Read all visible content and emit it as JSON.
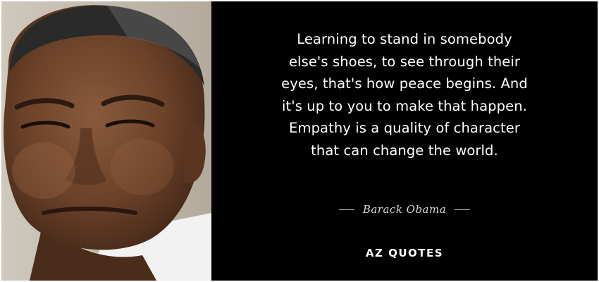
{
  "quote": {
    "lines": [
      "Learning to stand in somebody",
      "else's shoes, to see through their",
      "eyes, that's how peace begins. And",
      "it's up to you to make that happen.",
      "Empathy is a quality of character",
      "that can change the world."
    ]
  },
  "author": {
    "name": "Barack Obama"
  },
  "brand": {
    "logo_text": "AZ QUOTES"
  },
  "colors": {
    "background": "#000000",
    "quote_text": "#ffffff",
    "author_text": "#d9d9d9",
    "frame": "#ffffff"
  }
}
